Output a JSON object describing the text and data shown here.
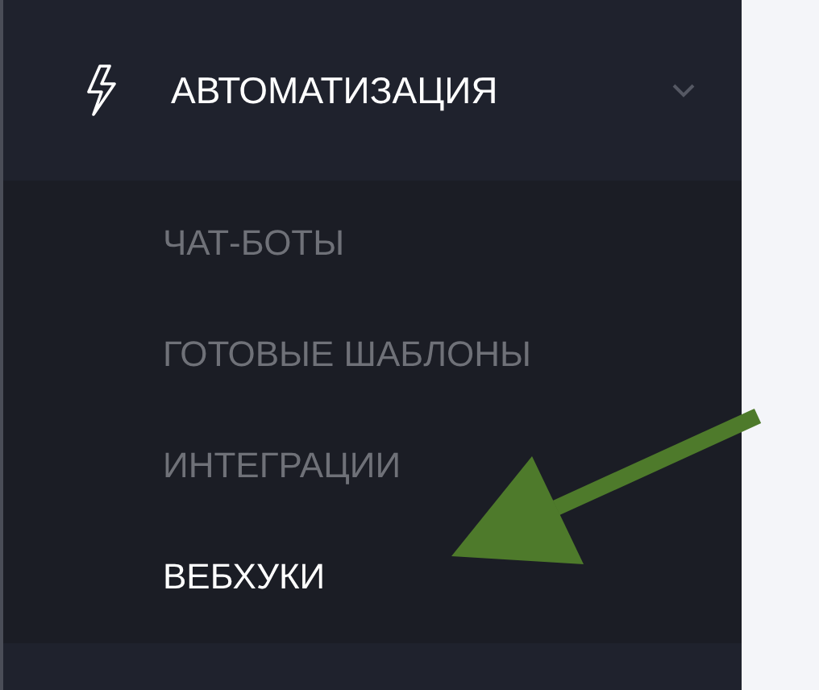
{
  "sidebar": {
    "group": {
      "label": "АВТОМАТИЗАЦИЯ",
      "expanded": true,
      "items": [
        {
          "label": "ЧАТ-БОТЫ",
          "selected": false
        },
        {
          "label": "ГОТОВЫЕ ШАБЛОНЫ",
          "selected": false
        },
        {
          "label": "ИНТЕГРАЦИИ",
          "selected": false
        },
        {
          "label": "ВЕБХУКИ",
          "selected": true
        }
      ]
    }
  }
}
